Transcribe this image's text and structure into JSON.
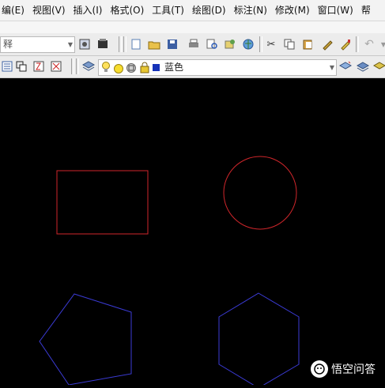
{
  "menubar": {
    "items": [
      "编(E)",
      "视图(V)",
      "插入(I)",
      "格式(O)",
      "工具(T)",
      "绘图(D)",
      "标注(N)",
      "修改(M)",
      "窗口(W)",
      "帮"
    ]
  },
  "toolbar1": {
    "style_combo_value": "释"
  },
  "toolbar2": {
    "color_combo_value": "蓝色"
  },
  "canvas": {
    "background": "#000000",
    "shapes": {
      "rectangle": {
        "color": "#d0262b"
      },
      "circle": {
        "color": "#d0262b"
      },
      "pentagon": {
        "color": "#3b3bd6"
      },
      "hexagon": {
        "color": "#3b3bd6"
      }
    }
  },
  "watermark": {
    "text": "悟空问答"
  }
}
